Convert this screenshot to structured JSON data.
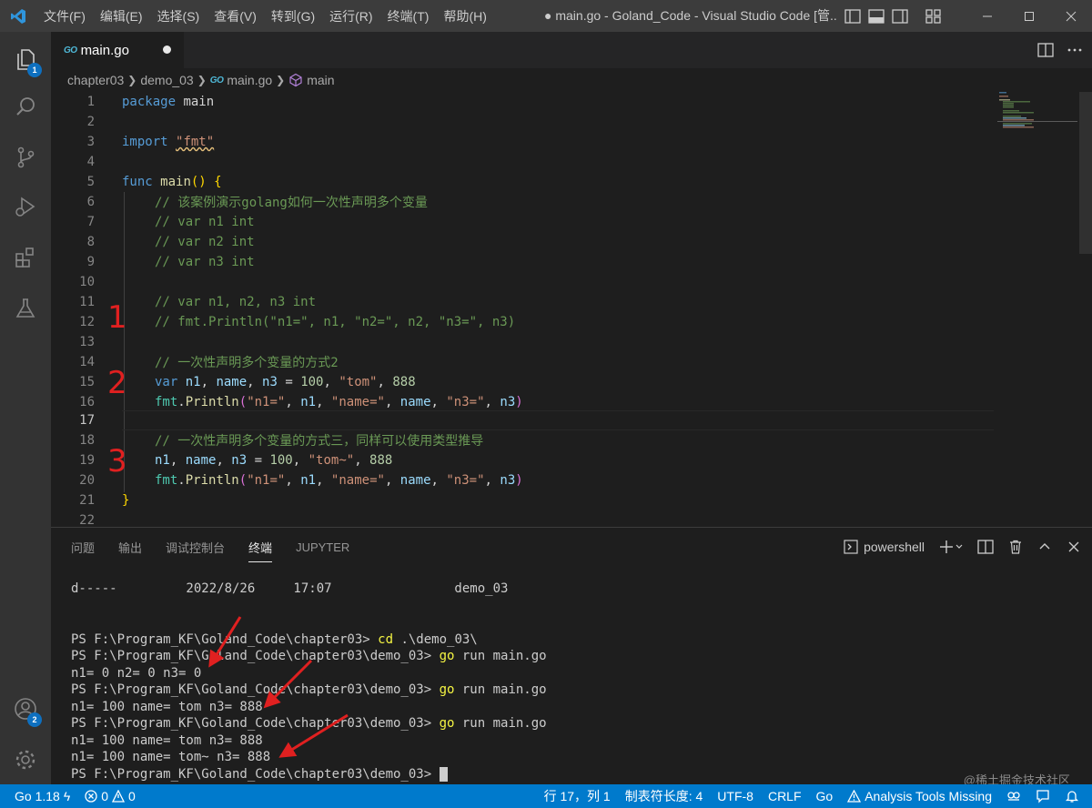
{
  "titlebar": {
    "menu": [
      "文件(F)",
      "编辑(E)",
      "选择(S)",
      "查看(V)",
      "转到(G)",
      "运行(R)",
      "终端(T)",
      "帮助(H)"
    ],
    "window_title": "● main.go - Goland_Code - Visual Studio Code [管..."
  },
  "activity": {
    "explorer_badge": "1",
    "accounts_badge": "2"
  },
  "tab": {
    "label": "main.go",
    "go_mark": "GO"
  },
  "breadcrumb": {
    "folder1": "chapter03",
    "folder2": "demo_03",
    "file": "main.go",
    "symbol": "main"
  },
  "editor": {
    "lines": [
      "1",
      "2",
      "3",
      "4",
      "5",
      "6",
      "7",
      "8",
      "9",
      "10",
      "11",
      "12",
      "13",
      "14",
      "15",
      "16",
      "17",
      "18",
      "19",
      "20",
      "21",
      "22"
    ],
    "c": {
      "l1a": "package",
      "l1b": " main",
      "l3a": "import",
      "l3b": " ",
      "l3c": "\"fmt\"",
      "l5a": "func",
      "l5b": " ",
      "l5c": "main",
      "l5d": "()",
      "l5e": " ",
      "l5f": "{",
      "l6": "// 该案例演示golang如何一次性声明多个变量",
      "l7": "// var n1 int",
      "l8": "// var n2 int",
      "l9": "// var n3 int",
      "l11": "// var n1, n2, n3 int",
      "l12": "// fmt.Println(\"n1=\", n1, \"n2=\", n2, \"n3=\", n3)",
      "l14": "// 一次性声明多个变量的方式2",
      "l15a": "var",
      "l15b": " n1",
      "l15c": ", ",
      "l15d": "name",
      "l15e": ", ",
      "l15f": "n3",
      "l15g": " = ",
      "l15h": "100",
      "l15i": ", ",
      "l15j": "\"tom\"",
      "l15k": ", ",
      "l15l": "888",
      "l16a": "fmt",
      "l16b": ".",
      "l16c": "Println",
      "l16d": "(",
      "l16e": "\"n1=\"",
      "l16f": ", ",
      "l16g": "n1",
      "l16h": ", ",
      "l16i": "\"name=\"",
      "l16j": ", ",
      "l16k": "name",
      "l16l": ", ",
      "l16m": "\"n3=\"",
      "l16n": ", ",
      "l16o": "n3",
      "l16p": ")",
      "l18": "// 一次性声明多个变量的方式三，同样可以使用类型推导",
      "l19a": "n1",
      "l19b": ", ",
      "l19c": "name",
      "l19d": ", ",
      "l19e": "n3",
      "l19f": " = ",
      "l19g": "100",
      "l19h": ", ",
      "l19i": "\"tom~\"",
      "l19j": ", ",
      "l19k": "888",
      "l20a": "fmt",
      "l20b": ".",
      "l20c": "Println",
      "l20d": "(",
      "l20e": "\"n1=\"",
      "l20f": ", ",
      "l20g": "n1",
      "l20h": ", ",
      "l20i": "\"name=\"",
      "l20j": ", ",
      "l20k": "name",
      "l20l": ", ",
      "l20m": "\"n3=\"",
      "l20n": ", ",
      "l20o": "n3",
      "l20p": ")",
      "l21": "}"
    },
    "annotations": [
      "1",
      "2",
      "3"
    ]
  },
  "panel": {
    "tabs": [
      "问题",
      "输出",
      "调试控制台",
      "终端",
      "JUPYTER"
    ],
    "terminal_name": "powershell",
    "terminal": {
      "t1": "d-----         2022/8/26     17:07                demo_03",
      "t2a": "PS F:\\Program_KF\\Goland_Code\\chapter03> ",
      "t2b": "cd",
      "t2c": " .\\demo_03\\",
      "t3a": "PS F:\\Program_KF\\Goland_Code\\chapter03\\demo_03> ",
      "t3b": "go",
      "t3c": " run main.go",
      "t4": "n1= 0 n2= 0 n3= 0",
      "t5a": "PS F:\\Program_KF\\Goland_Code\\chapter03\\demo_03> ",
      "t5b": "go",
      "t5c": " run main.go",
      "t6": "n1= 100 name= tom n3= 888",
      "t7a": "PS F:\\Program_KF\\Goland_Code\\chapter03\\demo_03> ",
      "t7b": "go",
      "t7c": " run main.go",
      "t8": "n1= 100 name= tom n3= 888",
      "t9": "n1= 100 name= tom~ n3= 888",
      "t10": "PS F:\\Program_KF\\Goland_Code\\chapter03\\demo_03> "
    }
  },
  "statusbar": {
    "go_version": "Go 1.18",
    "errors": "0",
    "warnings": "0",
    "position": "行 17，列 1",
    "tab_size": "制表符长度: 4",
    "encoding": "UTF-8",
    "eol": "CRLF",
    "language": "Go",
    "analysis": "Analysis Tools Missing"
  },
  "watermark": "@稀土掘金技术社区",
  "colors": {
    "accent": "#007acc",
    "annotation_red": "#e02020"
  }
}
